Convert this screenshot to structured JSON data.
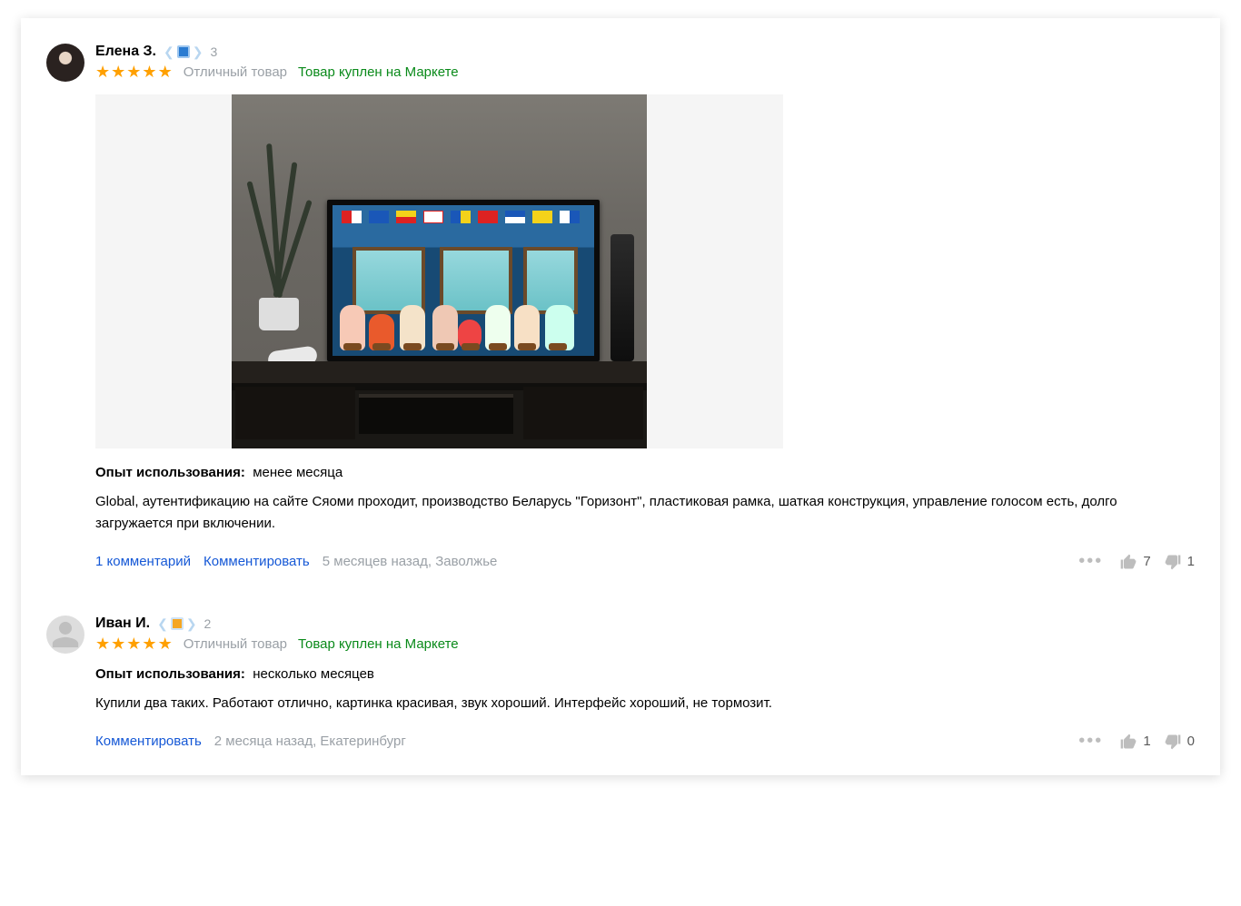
{
  "reviews": [
    {
      "author": "Елена З.",
      "level": "3",
      "level_color": "#2a7bd1",
      "stars": 5,
      "rating_label": "Отличный товар",
      "purchase_note": "Товар куплен на Маркете",
      "experience_label": "Опыт использования:",
      "experience_value": "менее месяца",
      "text": "Global, аутентификацию на сайте Сяоми проходит, производство Беларусь \"Горизонт\", пластиковая рамка, шаткая конструкция, управление голосом есть, долго загружается при включении.",
      "comments_link": "1 комментарий",
      "comment_action": "Комментировать",
      "meta": "5 месяцев назад, Заволжье",
      "likes": "7",
      "dislikes": "1"
    },
    {
      "author": "Иван И.",
      "level": "2",
      "level_color": "#f5a623",
      "stars": 5,
      "rating_label": "Отличный товар",
      "purchase_note": "Товар куплен на Маркете",
      "experience_label": "Опыт использования:",
      "experience_value": "несколько месяцев",
      "text": "Купили два таких. Работают отлично, картинка красивая, звук хороший. Интерфейс хороший, не тормозит.",
      "comment_action": "Комментировать",
      "meta": "2 месяца назад, Екатеринбург",
      "likes": "1",
      "dislikes": "0"
    }
  ]
}
